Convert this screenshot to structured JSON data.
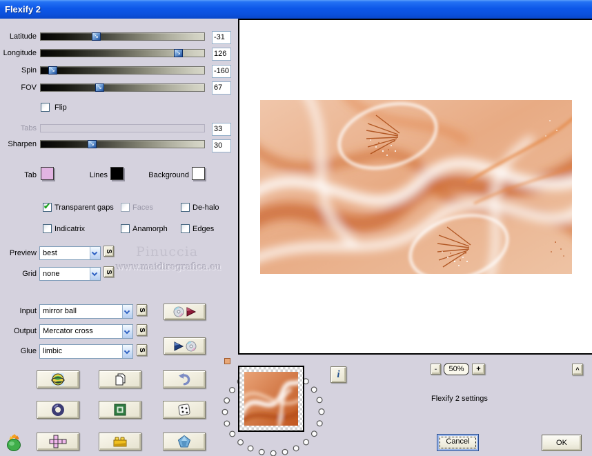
{
  "window": {
    "title": "Flexify 2"
  },
  "colors": {
    "titlebar_blue": "#0d57e8",
    "dialog_bg": "#d5d2de",
    "control_border_blue": "#7f9db9",
    "check_green": "#1ea41e",
    "button_face": "#eeebdb",
    "fractal_base": "#e8ab84"
  },
  "sliders": [
    {
      "label": "Latitude",
      "value": "-31",
      "disabled": false
    },
    {
      "label": "Longitude",
      "value": "126",
      "disabled": false
    },
    {
      "label": "Spin",
      "value": "-160",
      "disabled": false
    },
    {
      "label": "FOV",
      "value": "67",
      "disabled": false
    },
    {
      "label": "Tabs",
      "value": "33",
      "disabled": true
    },
    {
      "label": "Sharpen",
      "value": "30",
      "disabled": false
    }
  ],
  "flip": {
    "label": "Flip",
    "checked": false
  },
  "swatches": [
    {
      "label": "Tab",
      "color": "#e2b4e2"
    },
    {
      "label": "Lines",
      "color": "#000000"
    },
    {
      "label": "Background",
      "color": "#ffffff"
    }
  ],
  "checkboxes": {
    "transparent_gaps": {
      "label": "Transparent gaps",
      "checked": true,
      "disabled": false
    },
    "faces": {
      "label": "Faces",
      "checked": false,
      "disabled": true
    },
    "dehalo": {
      "label": "De-halo",
      "checked": false,
      "disabled": false
    },
    "indicatrix": {
      "label": "Indicatrix",
      "checked": false,
      "disabled": false
    },
    "anamorph": {
      "label": "Anamorph",
      "checked": false,
      "disabled": false
    },
    "edges": {
      "label": "Edges",
      "checked": false,
      "disabled": false
    }
  },
  "dropdowns": [
    {
      "label": "Preview",
      "value": "best"
    },
    {
      "label": "Grid",
      "value": "none"
    },
    {
      "label": "Input",
      "value": "mirror ball"
    },
    {
      "label": "Output",
      "value": "Mercator cross"
    },
    {
      "label": "Glue",
      "value": "limbic"
    }
  ],
  "s_button": {
    "label": "S"
  },
  "watermark": {
    "line1": "Pinuccia",
    "line2": "www.maidiregrafica.eu"
  },
  "check_glyph": "✔",
  "handle_glyph": "↘",
  "icons": {
    "grid_buttons": [
      "planet-sphere",
      "copy-pages",
      "undo-arrow",
      "torus-ring",
      "green-chip",
      "dice",
      "cube-net-cross",
      "lego-brick",
      "blue-gem"
    ],
    "io_buttons": [
      "cd-then-red-arrow",
      "blue-arrow-then-cd"
    ],
    "logo": "flaming-pear-logo",
    "info": "info-i"
  },
  "info_button": {
    "label": "i"
  },
  "zoom_controls": {
    "minus_label": "-",
    "level": "50%",
    "plus_label": "+",
    "caret_label": "^"
  },
  "status_text": "Flexify 2 settings",
  "actions": {
    "cancel_label": "Cancel",
    "ok_label": "OK"
  }
}
